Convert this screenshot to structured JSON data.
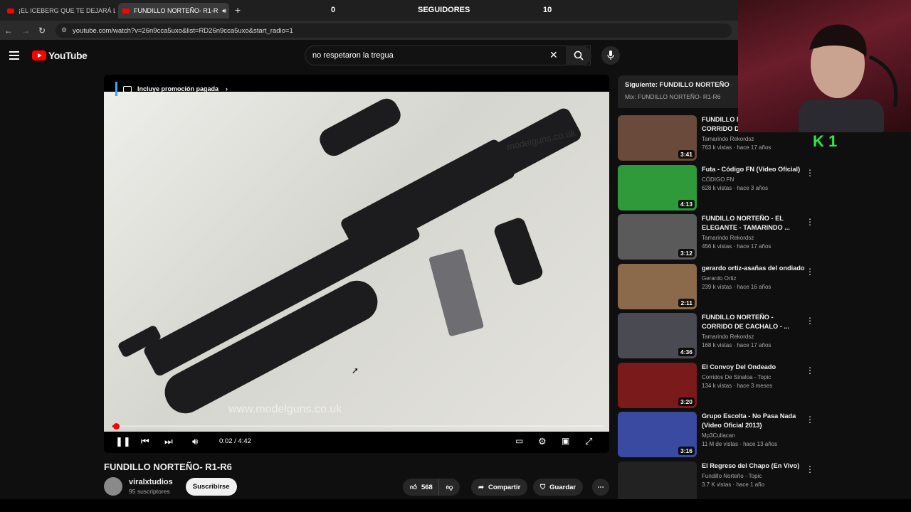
{
  "browser": {
    "tabs": [
      {
        "label": "¡EL ICEBERG QUE TE DEJARÁ LO",
        "active": false
      },
      {
        "label": "FUNDILLO NORTEÑO- R1-R",
        "active": true
      }
    ],
    "url": "youtube.com/watch?v=26n9cca5uxo&list=RD26n9cca5uxo&start_radio=1"
  },
  "stream_overlay": {
    "left_count": "0",
    "label": "SEGUIDORES",
    "right_count": "10",
    "badge": "K 1"
  },
  "youtube": {
    "logo_text": "YouTube",
    "search_value": "no respetaron la tregua"
  },
  "player": {
    "promo_label": "Incluye promoción pagada",
    "watermark": "www.modelguns.co.uk",
    "watermark_top": "modelguns.co.uk",
    "time": "0:02 / 4:42",
    "progress_fraction": 0.007
  },
  "video": {
    "title": "FUNDILLO NORTEÑO- R1-R6",
    "channel": "viralxtudios",
    "subscribers": "95 suscriptores",
    "subscribe_label": "Suscribirse",
    "likes": "568",
    "share_label": "Compartir",
    "save_label": "Guardar"
  },
  "sidebar": {
    "next_label": "Siguiente: FUNDILLO NORTEÑO - EL E",
    "mix_label": "Mix: FUNDILLO NORTEÑO- R1-R6",
    "items": [
      {
        "title": "FUNDILLO NORTEÑO - CORRIDO DE",
        "channel": "Tamarindo Rekordsz",
        "views": "763 k vistas · hace 17 años",
        "duration": "3:41",
        "thumb": "#6a4a3a"
      },
      {
        "title": "Futa - Código FN (Video Oficial)",
        "channel": "CÓDIGO FN",
        "views": "628 k vistas · hace 3 años",
        "duration": "4:13",
        "thumb": "#2f9a3a"
      },
      {
        "title": "FUNDILLO NORTEÑO - EL ELEGANTE - TAMARINDO ...",
        "channel": "Tamarindo Rekordsz",
        "views": "456 k vistas · hace 17 años",
        "duration": "3:12",
        "thumb": "#5a5a5a"
      },
      {
        "title": "gerardo ortiz-asañas del ondiado",
        "channel": "Gerardo Ortiz",
        "views": "239 k vistas · hace 16 años",
        "duration": "2:11",
        "thumb": "#8a6a4a"
      },
      {
        "title": "FUNDILLO NORTEÑO - CORRIDO DE CACHALO - ...",
        "channel": "Tamarindo Rekordsz",
        "views": "168 k vistas · hace 17 años",
        "duration": "4:36",
        "thumb": "#4a4a52"
      },
      {
        "title": "El Convoy Del Ondeado",
        "channel": "Corridos De Sinaloa - Topic",
        "views": "134 k vistas · hace 3 meses",
        "duration": "3:20",
        "thumb": "#7a1a1a"
      },
      {
        "title": "Grupo Escolta - No Pasa Nada (Video Oficial 2013)",
        "channel": "Mp3Culiacan",
        "views": "11 M de vistas · hace 13 años",
        "duration": "3:16",
        "thumb": "#3a4aa0"
      },
      {
        "title": "El Regreso del Chapo (En Vivo)",
        "channel": "Fundillo Norteño - Topic",
        "views": "3.7 K vistas · hace 1 año",
        "duration": "",
        "thumb": "#222222"
      }
    ]
  }
}
